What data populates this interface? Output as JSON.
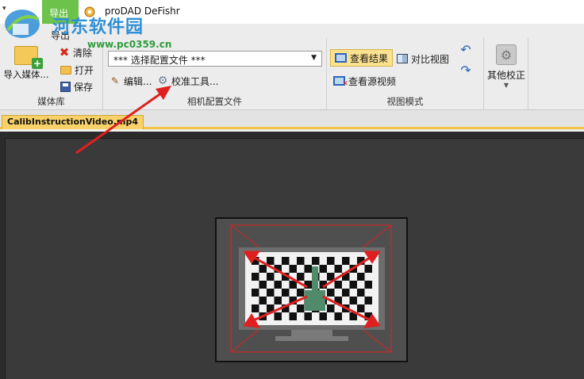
{
  "titlebar": {
    "sys_arrow": "▾",
    "quick_export": "导出",
    "app_title": "proDAD DeFishr"
  },
  "watermark": {
    "site_name": "河东软件园",
    "site_url": "www.pc0359.cn"
  },
  "ribbon": {
    "export_tab": "导出",
    "groups": {
      "media": {
        "label": "媒体库",
        "import_label": "导入媒体...",
        "clear_label": "清除",
        "open_label": "打开",
        "save_label": "保存"
      },
      "profile": {
        "label": "相机配置文件",
        "select_value": "*** 选择配置文件 ***",
        "edit_label": "编辑...",
        "calibrate_label": "校准工具..."
      },
      "view_mode": {
        "label": "视图模式",
        "result_label": "查看结果",
        "compare_label": "对比视图",
        "source_label": "查看源视频"
      },
      "other": {
        "label": "其他校正"
      }
    }
  },
  "document": {
    "tab_label": "CalibInstructionVideo.mp4"
  },
  "colors": {
    "accent_green": "#6cc24a",
    "tab_yellow": "#f8d268",
    "watermark_blue": "#2f8fd6",
    "watermark_green": "#2e9c3b",
    "arrow_red": "#e02020"
  }
}
